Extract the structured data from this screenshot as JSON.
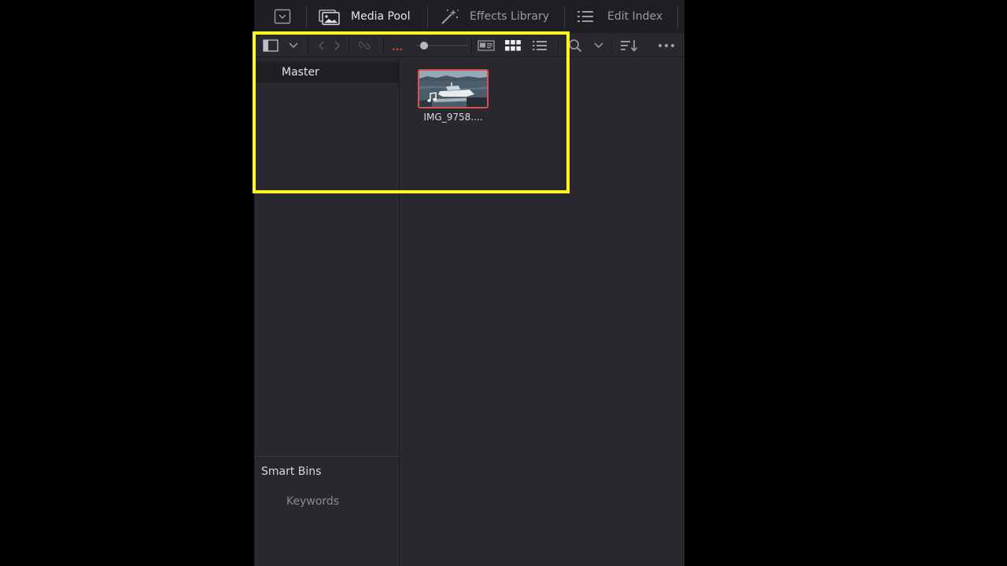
{
  "tabs": {
    "media_pool": "Media Pool",
    "effects_library": "Effects Library",
    "edit_index": "Edit Index"
  },
  "toolbar": {
    "more_indicator": "..."
  },
  "bins": {
    "master": "Master",
    "smart_bins_title": "Smart Bins",
    "keywords": "Keywords"
  },
  "clips": [
    {
      "name": "IMG_9758...."
    }
  ],
  "colors": {
    "accent_red": "#d9534a",
    "highlight": "#ffff1f"
  }
}
